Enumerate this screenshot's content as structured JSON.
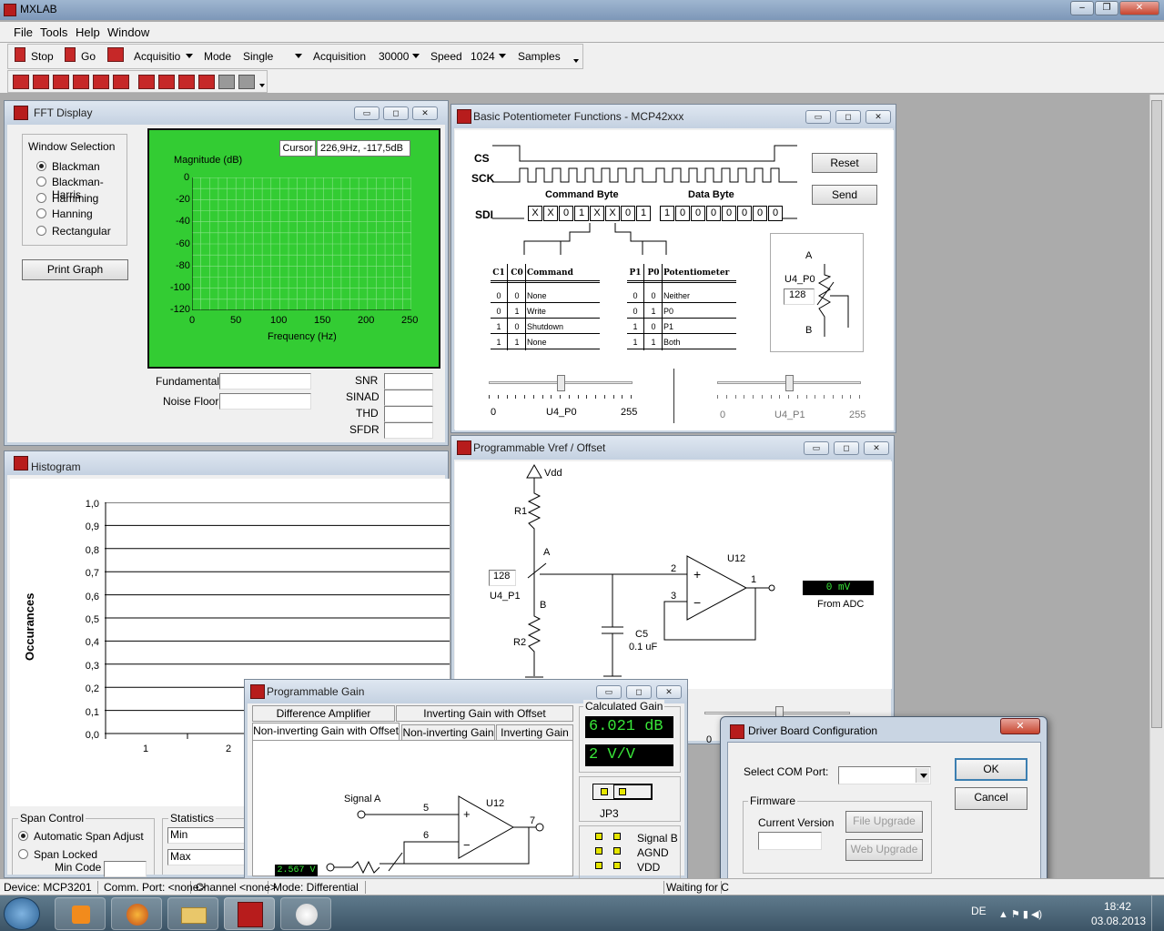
{
  "app": {
    "title": "MXLAB"
  },
  "menu": [
    "File",
    "Tools",
    "Help",
    "Window"
  ],
  "toolbar": {
    "stop": "Stop",
    "go": "Go",
    "acq_mode_value": "Acquisitio",
    "mode_label": "Mode",
    "mode_value": "Single",
    "acquisition_label": "Acquisition",
    "acquisition_value": "30000",
    "speed_label": "Speed",
    "speed_value": "1024",
    "samples_label": "Samples"
  },
  "fft": {
    "title": "FFT Display",
    "window_selection": "Window Selection",
    "options": [
      "Blackman",
      "Blackman-Harris",
      "Hamming",
      "Hanning",
      "Rectangular"
    ],
    "selected": 0,
    "print_graph": "Print Graph",
    "cursor_label": "Cursor",
    "cursor_value": "226,9Hz, -117,5dB",
    "ylabel": "Magnitude (dB)",
    "xlabel": "Frequency (Hz)",
    "yticks": [
      "0",
      "-20",
      "-40",
      "-60",
      "-80",
      "-100",
      "-120"
    ],
    "xticks": [
      "0",
      "50",
      "100",
      "150",
      "200",
      "250"
    ],
    "fundamental": "Fundamental",
    "noise_floor": "Noise Floor",
    "snr": "SNR",
    "sinad": "SINAD",
    "thd": "THD",
    "sfdr": "SFDR",
    "plot_bg": "#33cc33"
  },
  "histogram": {
    "title": "Histogram",
    "ylabel": "Occurances",
    "yticks": [
      "1,0",
      "0,9",
      "0,8",
      "0,7",
      "0,6",
      "0,5",
      "0,4",
      "0,3",
      "0,2",
      "0,1",
      "0,0"
    ],
    "xticks": [
      "1",
      "2"
    ],
    "span_control": "Span Control",
    "automatic": "Automatic Span Adjust",
    "span_locked": "Span Locked",
    "min_code": "Min Code",
    "statistics": "Statistics",
    "min": "Min",
    "max": "Max"
  },
  "pot": {
    "title": "Basic Potentiometer Functions - MCP42xxx",
    "cs": "CS",
    "sck": "SCK",
    "sdi": "SDI",
    "command_byte": "Command Byte",
    "data_byte": "Data Byte",
    "cmd_bits": [
      "X",
      "X",
      "0",
      "1",
      "X",
      "X",
      "0",
      "1"
    ],
    "data_bits": [
      "1",
      "0",
      "0",
      "0",
      "0",
      "0",
      "0",
      "0"
    ],
    "reset": "Reset",
    "send": "Send",
    "cmd_table": {
      "headers": [
        "C1",
        "C0",
        "Command"
      ],
      "rows": [
        [
          "0",
          "0",
          "None"
        ],
        [
          "0",
          "1",
          "Write"
        ],
        [
          "1",
          "0",
          "Shutdown"
        ],
        [
          "1",
          "1",
          "None"
        ]
      ]
    },
    "pot_table": {
      "headers": [
        "P1",
        "P0",
        "Potentiometer"
      ],
      "rows": [
        [
          "0",
          "0",
          "Neither"
        ],
        [
          "0",
          "1",
          "P0"
        ],
        [
          "1",
          "0",
          "P1"
        ],
        [
          "1",
          "1",
          "Both"
        ]
      ]
    },
    "chip_a": "A",
    "chip_b": "B",
    "chip_label": "U4_P0",
    "chip_value": "128",
    "slider1": {
      "min": "0",
      "label": "U4_P0",
      "max": "255",
      "value": 128
    },
    "slider2": {
      "min": "0",
      "label": "U4_P1",
      "max": "255",
      "value": 128
    }
  },
  "vref": {
    "title": "Programmable Vref / Offset",
    "vdd": "Vdd",
    "r1": "R1",
    "r2": "R2",
    "a": "A",
    "b": "B",
    "pot_value": "128",
    "pot_label": "U4_P1",
    "c5": "C5",
    "c5v": "0.1 uF",
    "u12": "U12",
    "pin2": "2",
    "pin3": "3",
    "pin1": "1",
    "adc_value": "0 mV",
    "from_adc": "From ADC",
    "slider_min": "0"
  },
  "gain": {
    "title": "Programmable Gain",
    "tabs_row1": [
      "Difference Amplifier",
      "Inverting Gain with Offset"
    ],
    "tabs_row2": [
      "Non-inverting Gain with Offset",
      "Non-inverting Gain",
      "Inverting Gain"
    ],
    "calculated_gain": "Calculated Gain",
    "db": "6.021 dB",
    "vv": "2 V/V",
    "jp3": "JP3",
    "signal_a": "Signal A",
    "u12": "U12",
    "pin5": "5",
    "pin6": "6",
    "pin7": "7",
    "voltage": "2.567 V",
    "signals": [
      "Signal B",
      "AGND",
      "VDD"
    ]
  },
  "driver": {
    "title": "Driver Board Configuration",
    "select_com": "Select COM Port:",
    "ok": "OK",
    "cancel": "Cancel",
    "firmware": "Firmware",
    "current_version": "Current Version",
    "file_upgrade": "File Upgrade",
    "web_upgrade": "Web Upgrade"
  },
  "status": {
    "device": "Device: MCP3201",
    "comm": "Comm. Port: <none>",
    "channel": "Channel <none>",
    "mode": "Mode: Differential",
    "waiting": "Waiting for C"
  },
  "tray": {
    "lang": "DE",
    "time": "18:42",
    "date": "03.08.2013"
  }
}
